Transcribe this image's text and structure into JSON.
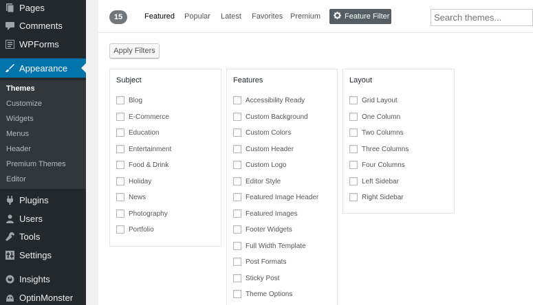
{
  "sidebar": {
    "items": [
      {
        "label": "Pages",
        "icon": "pages-icon"
      },
      {
        "label": "Comments",
        "icon": "comments-icon"
      },
      {
        "label": "WPForms",
        "icon": "wpforms-icon"
      },
      {
        "label": "Appearance",
        "icon": "paintbrush-icon"
      },
      {
        "label": "Plugins",
        "icon": "plug-icon"
      },
      {
        "label": "Users",
        "icon": "users-icon"
      },
      {
        "label": "Tools",
        "icon": "wrench-icon"
      },
      {
        "label": "Settings",
        "icon": "settings-icon"
      },
      {
        "label": "Insights",
        "icon": "insights-icon"
      },
      {
        "label": "OptinMonster",
        "icon": "optinmonster-icon"
      }
    ],
    "submenu": [
      "Themes",
      "Customize",
      "Widgets",
      "Menus",
      "Header",
      "Premium Themes",
      "Editor"
    ]
  },
  "filterbar": {
    "count": "15",
    "tabs": [
      "Featured",
      "Popular",
      "Latest",
      "Favorites",
      "Premium"
    ],
    "feature_filter_label": "Feature Filter",
    "search_placeholder": "Search themes..."
  },
  "apply_filters_label": "Apply Filters",
  "filters": {
    "subject": {
      "title": "Subject",
      "options": [
        "Blog",
        "E-Commerce",
        "Education",
        "Entertainment",
        "Food & Drink",
        "Holiday",
        "News",
        "Photography",
        "Portfolio"
      ]
    },
    "features": {
      "title": "Features",
      "options": [
        "Accessibility Ready",
        "Custom Background",
        "Custom Colors",
        "Custom Header",
        "Custom Logo",
        "Editor Style",
        "Featured Image Header",
        "Featured Images",
        "Footer Widgets",
        "Full Width Template",
        "Post Formats",
        "Sticky Post",
        "Theme Options"
      ]
    },
    "layout": {
      "title": "Layout",
      "options": [
        "Grid Layout",
        "One Column",
        "Two Columns",
        "Three Columns",
        "Four Columns",
        "Left Sidebar",
        "Right Sidebar"
      ]
    }
  },
  "colors": {
    "sidebar_bg": "#23282d",
    "active_bg": "#0073aa",
    "submenu_bg": "#32373c"
  }
}
